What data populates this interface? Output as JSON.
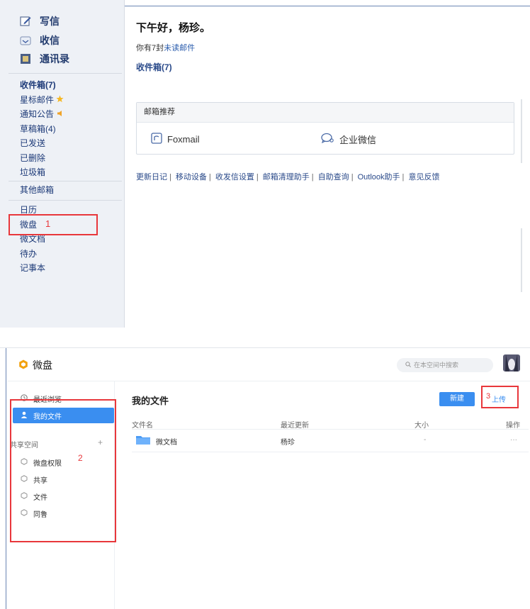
{
  "mail": {
    "primary": [
      {
        "label": "写信",
        "icon": "pencil-icon"
      },
      {
        "label": "收信",
        "icon": "inbox-icon"
      },
      {
        "label": "通讯录",
        "icon": "contacts-icon"
      }
    ],
    "folders": [
      {
        "label": "收件箱(7)",
        "bold": true
      },
      {
        "label": "星标邮件",
        "icon": "star-icon"
      },
      {
        "label": "通知公告",
        "icon": "speaker-icon"
      },
      {
        "label": "草稿箱(4)"
      },
      {
        "label": "已发送"
      },
      {
        "label": "已删除"
      },
      {
        "label": "垃圾箱"
      }
    ],
    "other_mailbox": "其他邮箱",
    "apps": [
      "日历",
      "微盘",
      "微文档",
      "待办",
      "记事本"
    ],
    "annotation_1": "1",
    "greeting_prefix": "下午好，",
    "greeting_name": "杨珍。",
    "unread_prefix": "你有7封",
    "unread_link": "未读邮件",
    "inbox_link": "收件箱(7)",
    "recommend": {
      "header": "邮箱推荐",
      "items": [
        {
          "label": "Foxmail",
          "icon": "foxmail-icon"
        },
        {
          "label": "企业微信",
          "icon": "wecom-icon"
        }
      ]
    },
    "footer_links": [
      "更新日记",
      "移动设备",
      "收发信设置",
      "邮箱清理助手",
      "自助查询",
      "Outlook助手",
      "意见反馈"
    ],
    "colors": {
      "accent": "#2a5cad",
      "red_annotation": "#e8373b"
    }
  },
  "weipan": {
    "app_name": "微盘",
    "search_placeholder": "在本空间中搜索",
    "sidebar": {
      "recent": "最近浏览",
      "my_files": "我的文件",
      "shared_section": "共享空间",
      "add": "+",
      "spaces": [
        "微盘权限",
        "共享",
        "文件",
        "同鲁"
      ]
    },
    "annotation_2": "2",
    "annotation_3": "3",
    "page_title": "我的文件",
    "new_button": "新建",
    "upload_button": "上传",
    "columns": {
      "name": "文件名",
      "updated": "最近更新",
      "size": "大小",
      "actions": "操作"
    },
    "files": [
      {
        "name": "微文档",
        "updated": "杨珍",
        "size": "-",
        "actions": "···"
      }
    ],
    "colors": {
      "primary": "#3a8ef0"
    }
  }
}
